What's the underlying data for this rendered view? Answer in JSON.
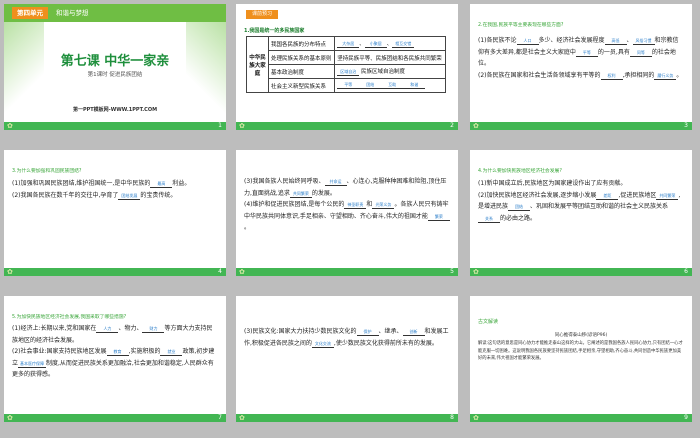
{
  "slides": [
    {
      "unit_label": "第四单元",
      "unit_title": "和谐与梦想",
      "lesson_title": "第七课 中华一家亲",
      "period": "第1课时  促进民族团结",
      "source": "第一PPT模板网-WWW.1PPT.COM",
      "number": "1"
    },
    {
      "tag": "课前预习",
      "question": "1.我国是统一的多民族国家",
      "table": {
        "group_label": "中华民族大家庭",
        "rows": [
          {
            "pre": "我国各民族的分布特点",
            "blanks": [
              "大杂居",
              "小聚居",
              "相互交错"
            ],
            "post": ""
          },
          {
            "pre": "处理民族关系的基本原则",
            "blanks": [],
            "post": "坚持民族平等、民族团结和各民族共同繁荣"
          },
          {
            "pre": "基本政治制度",
            "blanks": [
              "区域自治"
            ],
            "post": "民族区域自治制度"
          },
          {
            "pre": "社会主义新型民族关系",
            "blanks": [
              "平等",
              "团结",
              "互助",
              "和谐"
            ],
            "post": ""
          }
        ]
      },
      "number": "2"
    },
    {
      "question": "2.在我国,民族平等主要表现在哪些方面?",
      "p1_a": "(1)各民族不论",
      "p1_b": "多少、经济社会发展程度",
      "p1_c": "、",
      "p1_d": "和宗教信仰有多大差异,都是社会主义大家庭中",
      "p1_e": "的一员,具有",
      "p1_f": "的社会地位。",
      "p2_a": "(2)各民族在国家和社会生活各领域享有平等的",
      "p2_b": ",承担相同的",
      "p2_c": "。",
      "blanks": [
        "人口",
        "高低",
        "风俗习惯",
        "平等",
        "同等",
        "权利",
        "履行义务"
      ],
      "number": "3"
    },
    {
      "question": "3.为什么要加强和巩固民族团结?",
      "p1": "(1)加强和巩固民族团结,维护祖国统一,是中华民族的",
      "p1_end": "利益。",
      "p2": "(2)我国各民族在数千年的交往中,孕育了",
      "p2_end": "的宝贵传统。",
      "blanks": [
        "最高",
        "团结发展"
      ],
      "number": "4"
    },
    {
      "p1": "(3)我国各族人民始终同呼吸、",
      "p1_b": "、心连心,克服种种困难和险阻,顶住压力,直面挑战,追求",
      "p1_c": "的发展。",
      "p2": "(4)维护和促进民族团结,是每个公民的",
      "p2_b": "和",
      "p2_c": "。各族人民只有铸牢中华民族共同体意识,手足相亲、守望相助、齐心奋斗,伟大的祖国才能",
      "p2_d": "。",
      "blanks": [
        "共命运",
        "共同繁荣",
        "神圣职责",
        "光荣义务",
        "繁荣"
      ],
      "number": "5"
    },
    {
      "question": "4.为什么要加快民族地区经济社会发展?",
      "p1": "(1)新中国成立后,民族地区为国家建设作出了应有贡献。",
      "p2": "(2)加快民族地区经济社会发展,逐步缩小发展",
      "p2_b": ",促进民族地区",
      "p2_c": ",是增进民族",
      "p2_d": "、巩固和发展平等团结互助和谐的社会主义民族关系",
      "p2_e": "的必由之路。",
      "blanks": [
        "差距",
        "共同繁荣",
        "团结",
        "关系"
      ],
      "number": "6"
    },
    {
      "question": "5.为加快民族地区经济社会发展,我国采取了哪些措施?",
      "p1": "(1)经济上:长期以来,党和国家在",
      "p1_b": "、物力、",
      "p1_c": "等方面大力支持民族地区的经济社会发展。",
      "p2": "(2)社会事业:国家支持民族地区发展",
      "p2_b": ",实施积极的",
      "p2_c": "政策,初步建立",
      "p2_d": "制度,从而促进民族关系更加融洽,社会更加和谐稳定,人民群众有更多的获得感。",
      "blanks": [
        "人力",
        "财力",
        "教育",
        "就业",
        "基本医疗保障"
      ],
      "number": "7"
    },
    {
      "p1": "(3)民族文化:国家大力扶持少数民族文化的",
      "p1_b": "、继承、",
      "p1_c": "和发展工作,积极促进各民族之间的",
      "p1_d": ",使少数民族文化获得前所未有的发展。",
      "blanks": [
        "保护",
        "创新",
        "文化交流"
      ],
      "number": "8"
    },
    {
      "title": "古文解读",
      "quote": "同心推得泰山移(谚语P96)",
      "explanation": "解读:这句话的意思是同心协力才能推走泰山这样的大山。它阐述的是我国各族人民同心协力,只有团结一心才能克服一切困难。这说明我国各民族要坚持民族团结,手足相亲,守望相助,齐心奋斗,共同创造中华民族更加美好的未来,伟大祖国才能繁荣发展。",
      "number": "9"
    }
  ],
  "colors": {
    "green": "#42b653",
    "orange": "#ef8f1d",
    "blue": "#2a7dc9"
  }
}
